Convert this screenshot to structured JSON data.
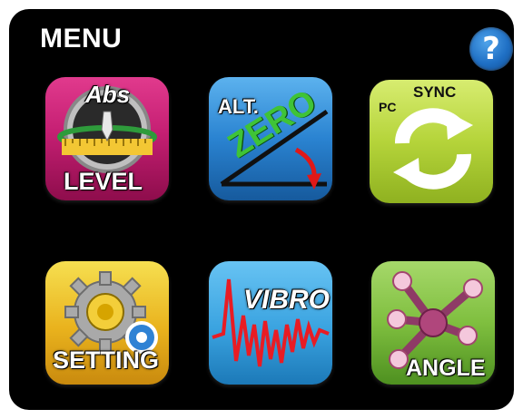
{
  "menu": {
    "title": "MENU",
    "help_label": "?"
  },
  "tiles": [
    {
      "id": "level",
      "top_label": "Abs",
      "label": "LEVEL"
    },
    {
      "id": "zero",
      "top_label": "ALT.",
      "label": "ZERO"
    },
    {
      "id": "sync",
      "top_label": "SYNC",
      "sub_label": "PC",
      "label": ""
    },
    {
      "id": "setting",
      "label": "SETTING"
    },
    {
      "id": "vibro",
      "label": "VIBRO"
    },
    {
      "id": "angle",
      "label": "ANGLE"
    }
  ],
  "icons": {
    "level": "level-icon",
    "zero": "alt-zero-icon",
    "sync": "pc-sync-icon",
    "setting": "gear-icon",
    "vibro": "vibration-wave-icon",
    "angle": "molecule-angle-icon",
    "help": "help-icon"
  }
}
